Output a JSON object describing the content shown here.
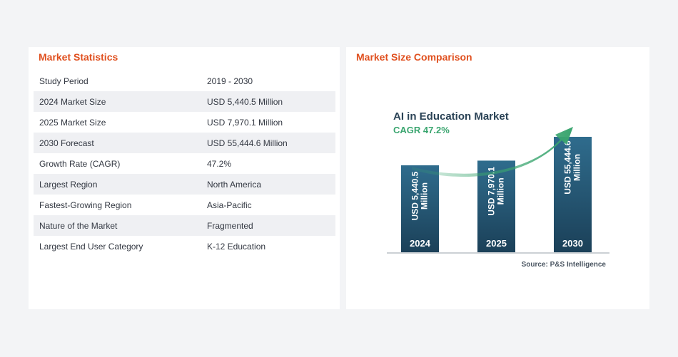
{
  "stats": {
    "title": "Market Statistics",
    "rows": [
      {
        "label": "Study Period",
        "value": "2019 - 2030"
      },
      {
        "label": "2024 Market Size",
        "value": "USD 5,440.5 Million"
      },
      {
        "label": "2025 Market Size",
        "value": "USD 7,970.1 Million"
      },
      {
        "label": "2030 Forecast",
        "value": "USD 55,444.6 Million"
      },
      {
        "label": "Growth Rate (CAGR)",
        "value": "47.2%"
      },
      {
        "label": "Largest Region",
        "value": "North America"
      },
      {
        "label": "Fastest-Growing Region",
        "value": "Asia-Pacific"
      },
      {
        "label": "Nature of the Market",
        "value": "Fragmented"
      },
      {
        "label": "Largest End User Category",
        "value": "K-12 Education"
      }
    ]
  },
  "comparison": {
    "title": "Market Size Comparison"
  },
  "chart_data": {
    "type": "bar",
    "title": "AI in Education Market",
    "subtitle": "CAGR 47.2%",
    "categories": [
      "2024",
      "2025",
      "2030"
    ],
    "values": [
      5440.5,
      7970.1,
      55444.6
    ],
    "data_labels": [
      "USD 5,440.5 Million",
      "USD 7,970.1 Million",
      "USD 55,444.6 Million"
    ],
    "source": "Source: P&S Intelligence",
    "colors": {
      "bar_top": "#2f6c8d",
      "bar_bottom": "#1b4058",
      "arrow": "#3aa56f"
    }
  }
}
